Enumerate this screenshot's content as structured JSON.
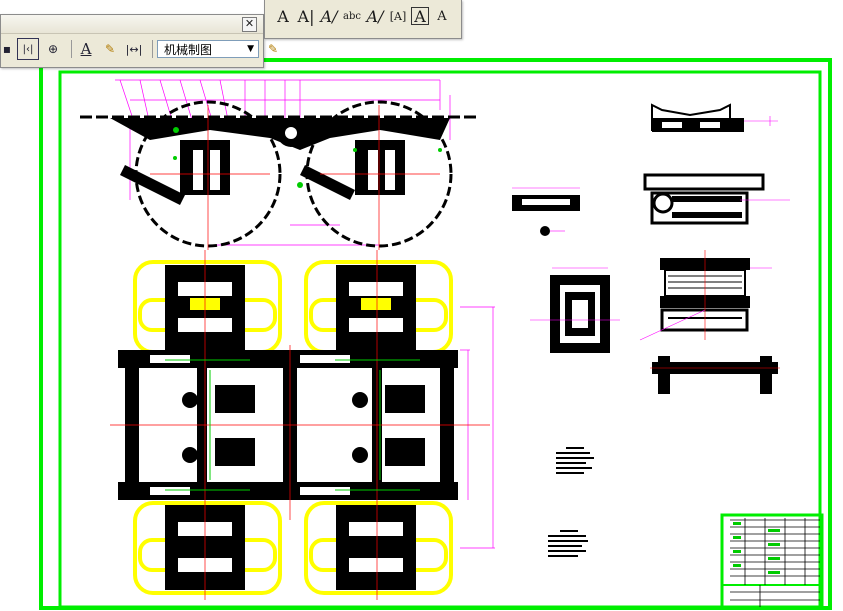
{
  "toolbar_left": {
    "style_combo_value": "机械制图",
    "close_glyph": "✕",
    "combo_arrow": "▼"
  },
  "toolbar_right": {
    "buttons": [
      "A",
      "A|",
      "A/",
      "abc",
      "A/",
      "[A]",
      "A",
      "A"
    ]
  },
  "colors": {
    "frame_green": "#00ee00",
    "dim_magenta": "#ff00ff",
    "yellow_outline": "#ffff00",
    "centerline_red": "#ff0000",
    "toolbar_bg": "#ece9d8"
  }
}
